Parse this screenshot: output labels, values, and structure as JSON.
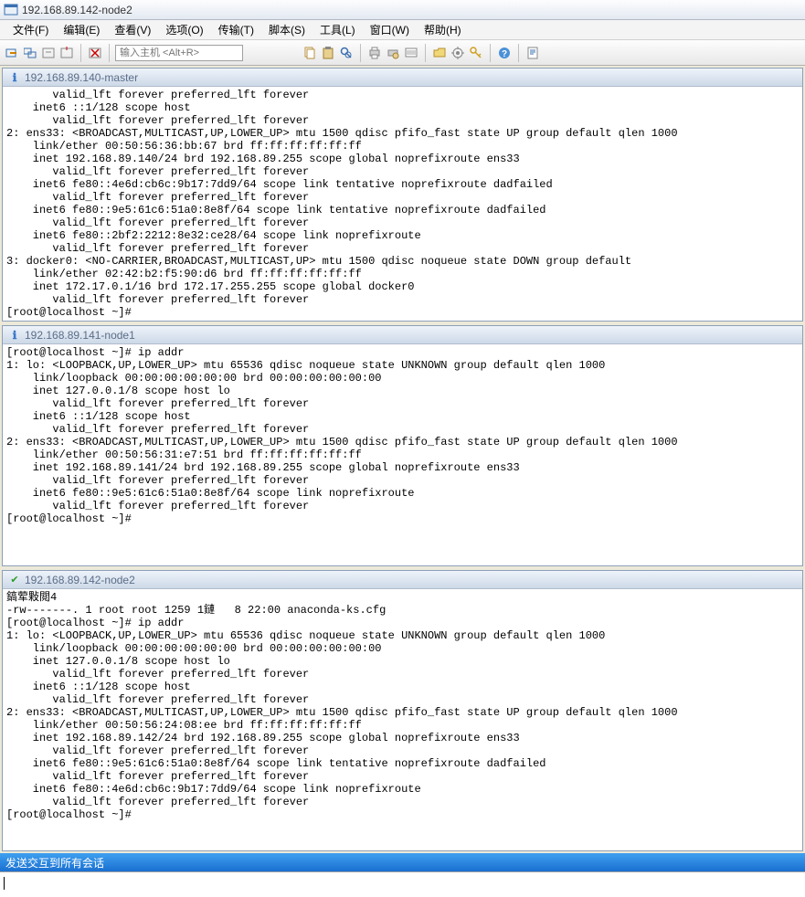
{
  "window": {
    "title": "192.168.89.142-node2"
  },
  "menu": {
    "file": "文件(F)",
    "edit": "编辑(E)",
    "view": "查看(V)",
    "options": "选项(O)",
    "transfer": "传输(T)",
    "script": "脚本(S)",
    "tools": "工具(L)",
    "window": "窗口(W)",
    "help": "帮助(H)"
  },
  "toolbar": {
    "host_placeholder": "输入主机 <Alt+R>"
  },
  "panes": [
    {
      "title": "192.168.89.140-master",
      "status": "info",
      "text": "       valid_lft forever preferred_lft forever\n    inet6 ::1/128 scope host\n       valid_lft forever preferred_lft forever\n2: ens33: <BROADCAST,MULTICAST,UP,LOWER_UP> mtu 1500 qdisc pfifo_fast state UP group default qlen 1000\n    link/ether 00:50:56:36:bb:67 brd ff:ff:ff:ff:ff:ff\n    inet 192.168.89.140/24 brd 192.168.89.255 scope global noprefixroute ens33\n       valid_lft forever preferred_lft forever\n    inet6 fe80::4e6d:cb6c:9b17:7dd9/64 scope link tentative noprefixroute dadfailed\n       valid_lft forever preferred_lft forever\n    inet6 fe80::9e5:61c6:51a0:8e8f/64 scope link tentative noprefixroute dadfailed\n       valid_lft forever preferred_lft forever\n    inet6 fe80::2bf2:2212:8e32:ce28/64 scope link noprefixroute\n       valid_lft forever preferred_lft forever\n3: docker0: <NO-CARRIER,BROADCAST,MULTICAST,UP> mtu 1500 qdisc noqueue state DOWN group default\n    link/ether 02:42:b2:f5:90:d6 brd ff:ff:ff:ff:ff:ff\n    inet 172.17.0.1/16 brd 172.17.255.255 scope global docker0\n       valid_lft forever preferred_lft forever\n[root@localhost ~]#"
    },
    {
      "title": "192.168.89.141-node1",
      "status": "info",
      "text": "[root@localhost ~]# ip addr\n1: lo: <LOOPBACK,UP,LOWER_UP> mtu 65536 qdisc noqueue state UNKNOWN group default qlen 1000\n    link/loopback 00:00:00:00:00:00 brd 00:00:00:00:00:00\n    inet 127.0.0.1/8 scope host lo\n       valid_lft forever preferred_lft forever\n    inet6 ::1/128 scope host\n       valid_lft forever preferred_lft forever\n2: ens33: <BROADCAST,MULTICAST,UP,LOWER_UP> mtu 1500 qdisc pfifo_fast state UP group default qlen 1000\n    link/ether 00:50:56:31:e7:51 brd ff:ff:ff:ff:ff:ff\n    inet 192.168.89.141/24 brd 192.168.89.255 scope global noprefixroute ens33\n       valid_lft forever preferred_lft forever\n    inet6 fe80::9e5:61c6:51a0:8e8f/64 scope link noprefixroute\n       valid_lft forever preferred_lft forever\n[root@localhost ~]#\n\n\n\n"
    },
    {
      "title": "192.168.89.142-node2",
      "status": "active",
      "text": "鎬荤敤閲4\n-rw-------. 1 root root 1259 1鏈   8 22:00 anaconda-ks.cfg\n[root@localhost ~]# ip addr\n1: lo: <LOOPBACK,UP,LOWER_UP> mtu 65536 qdisc noqueue state UNKNOWN group default qlen 1000\n    link/loopback 00:00:00:00:00:00 brd 00:00:00:00:00:00\n    inet 127.0.0.1/8 scope host lo\n       valid_lft forever preferred_lft forever\n    inet6 ::1/128 scope host\n       valid_lft forever preferred_lft forever\n2: ens33: <BROADCAST,MULTICAST,UP,LOWER_UP> mtu 1500 qdisc pfifo_fast state UP group default qlen 1000\n    link/ether 00:50:56:24:08:ee brd ff:ff:ff:ff:ff:ff\n    inet 192.168.89.142/24 brd 192.168.89.255 scope global noprefixroute ens33\n       valid_lft forever preferred_lft forever\n    inet6 fe80::9e5:61c6:51a0:8e8f/64 scope link tentative noprefixroute dadfailed\n       valid_lft forever preferred_lft forever\n    inet6 fe80::4e6d:cb6c:9b17:7dd9/64 scope link noprefixroute\n       valid_lft forever preferred_lft forever\n[root@localhost ~]#"
    }
  ],
  "footer": {
    "label": "发送交互到所有会话"
  }
}
